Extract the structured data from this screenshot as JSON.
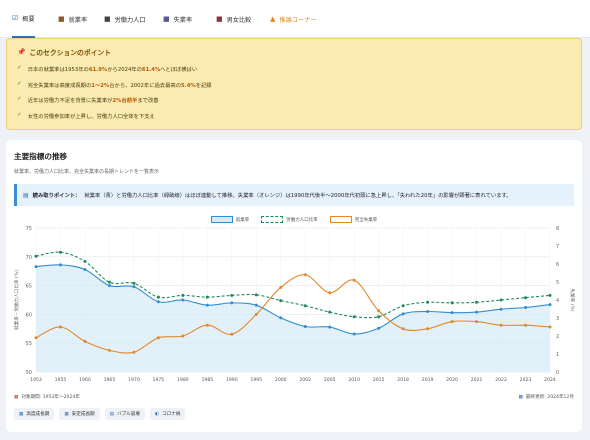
{
  "tabs": [
    {
      "icon": "☑",
      "label": "概要",
      "active": true
    },
    {
      "icon": "■",
      "label": "就業率"
    },
    {
      "icon": "■",
      "label": "労働力人口"
    },
    {
      "icon": "■",
      "label": "失業率"
    },
    {
      "icon": "■",
      "label": "男女比較"
    },
    {
      "icon": "▲",
      "label": "推論コーナー",
      "warn": true
    }
  ],
  "points": {
    "title": "このセクションのポイント",
    "items": [
      {
        "a": "日本の就業率は1953年の",
        "b": "61.9%",
        "c": "から2024年の",
        "d": "61.4%",
        "e": "へとほぼ横ばい"
      },
      {
        "a": "完全失業率は高度成長期の",
        "b": "1〜2%",
        "c": "台から、2002年に過去最高の",
        "d": "5.4%",
        "e": "を記録"
      },
      {
        "a": "近年は労働力不足を背景に失業率が",
        "b": "2%台前半",
        "c": "まで改善",
        "d": "",
        "e": ""
      },
      {
        "a": "女性の労働参加率が上昇し、労働力人口全体を下支え",
        "b": "",
        "c": "",
        "d": "",
        "e": ""
      }
    ]
  },
  "card": {
    "title": "主要指標の推移",
    "subtitle": "就業率、労働力人口比率、完全失業率の長期トレンドを一覧表示",
    "note_label": "読み取りポイント：",
    "note_text": "就業率（青）と労働力人口比率（緑破線）はほぼ連動して推移。失業率（オレンジ）は1990年代後半〜2000年代初頭に急上昇し、「失われた20年」の影響が顕著に表れています。",
    "period": "対象期間: 1953年〜2024年",
    "updated": "最終更新: 2024年12月",
    "chips": [
      "高度成長期",
      "安定成長期",
      "バブル崩壊",
      "コロナ禍"
    ]
  },
  "chart_data": {
    "type": "line",
    "x": [
      "1953",
      "1955",
      "1960",
      "1965",
      "1970",
      "1975",
      "1980",
      "1985",
      "1990",
      "1995",
      "2000",
      "2002",
      "2005",
      "2010",
      "2015",
      "2018",
      "2019",
      "2020",
      "2021",
      "2022",
      "2023",
      "2024"
    ],
    "series": [
      {
        "name": "就業率",
        "axis": "left",
        "color": "#2f8fd0",
        "values": [
          68.3,
          68.6,
          67.8,
          65.0,
          64.8,
          62.2,
          62.5,
          61.6,
          62.0,
          61.6,
          59.4,
          57.9,
          57.8,
          56.6,
          57.6,
          60.1,
          60.5,
          60.3,
          60.4,
          60.9,
          61.2,
          61.7
        ]
      },
      {
        "name": "労働力人口比率",
        "axis": "left",
        "color": "#1e8a5a",
        "dashed": true,
        "values": [
          70.1,
          70.8,
          69.2,
          65.6,
          65.4,
          63.0,
          63.3,
          63.0,
          63.3,
          63.4,
          62.4,
          61.5,
          60.4,
          59.6,
          59.6,
          61.5,
          62.1,
          62.0,
          62.1,
          62.5,
          62.9,
          63.3
        ]
      },
      {
        "name": "完全失業率",
        "axis": "right",
        "color": "#e08a2a",
        "values": [
          1.9,
          2.5,
          1.7,
          1.2,
          1.1,
          1.9,
          2.0,
          2.6,
          2.1,
          3.2,
          4.7,
          5.4,
          4.4,
          5.1,
          3.4,
          2.4,
          2.4,
          2.8,
          2.8,
          2.6,
          2.6,
          2.5
        ]
      }
    ],
    "yleft": {
      "label": "就業率・労働力人口比率 (%)",
      "min": 50,
      "max": 75,
      "ticks": [
        50,
        55,
        60,
        65,
        70,
        75
      ]
    },
    "yright": {
      "label": "失業率 (%)",
      "min": 0,
      "max": 8,
      "ticks": [
        0,
        1,
        2,
        3,
        4,
        5,
        6,
        7,
        8
      ]
    },
    "grid": true,
    "legend": "top-center"
  }
}
